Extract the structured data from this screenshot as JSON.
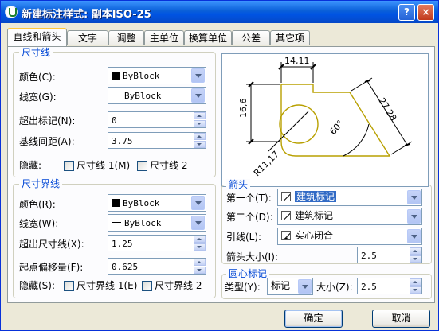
{
  "window": {
    "title": "新建标注样式: 副本ISO-25",
    "help_label": "?",
    "close_label": "×"
  },
  "tabs": [
    {
      "label": "直线和箭头",
      "active": true
    },
    {
      "label": "文字",
      "active": false
    },
    {
      "label": "调整",
      "active": false
    },
    {
      "label": "主单位",
      "active": false
    },
    {
      "label": "换算单位",
      "active": false
    },
    {
      "label": "公差",
      "active": false
    },
    {
      "label": "其它项",
      "active": false
    }
  ],
  "dim_line": {
    "title": "尺寸线",
    "color_label": "颜色(C):",
    "color_value": "ByBlock",
    "lineweight_label": "线宽(G):",
    "lineweight_value": "ByBlock",
    "extend_label": "超出标记(N):",
    "extend_value": "0",
    "baseline_label": "基线间距(A):",
    "baseline_value": "3.75",
    "suppress_label": "隐藏:",
    "suppress_1": "尺寸线 1(M)",
    "suppress_2": "尺寸线 2"
  },
  "ext_line": {
    "title": "尺寸界线",
    "color_label": "颜色(R):",
    "color_value": "ByBlock",
    "lineweight_label": "线宽(W):",
    "lineweight_value": "ByBlock",
    "extend_label": "超出尺寸线(X):",
    "extend_value": "1.25",
    "offset_label": "起点偏移量(F):",
    "offset_value": "0.625",
    "suppress_label": "隐藏(S):",
    "suppress_1": "尺寸界线 1(E)",
    "suppress_2": "尺寸界线 2"
  },
  "preview": {
    "dim_top": "14,11",
    "dim_left": "16,6",
    "dim_right": "27,28",
    "dim_angle": "60°",
    "dim_radius": "R11,17"
  },
  "arrows": {
    "title": "箭头",
    "first_label": "第一个(T):",
    "first_value": "建筑标记",
    "second_label": "第二个(D):",
    "second_value": "建筑标记",
    "leader_label": "引线(L):",
    "leader_value": "实心闭合",
    "size_label": "箭头大小(I):",
    "size_value": "2.5"
  },
  "center": {
    "title": "圆心标记",
    "type_label": "类型(Y):",
    "type_value": "标记",
    "size_label": "大小(Z):",
    "size_value": "2.5"
  },
  "buttons": {
    "ok": "确定",
    "cancel": "取消"
  },
  "colors": {
    "title_bar": "#0054e3",
    "group_title": "#0046d5",
    "selection": "#316ac5",
    "preview_shape": "#b8a000"
  }
}
